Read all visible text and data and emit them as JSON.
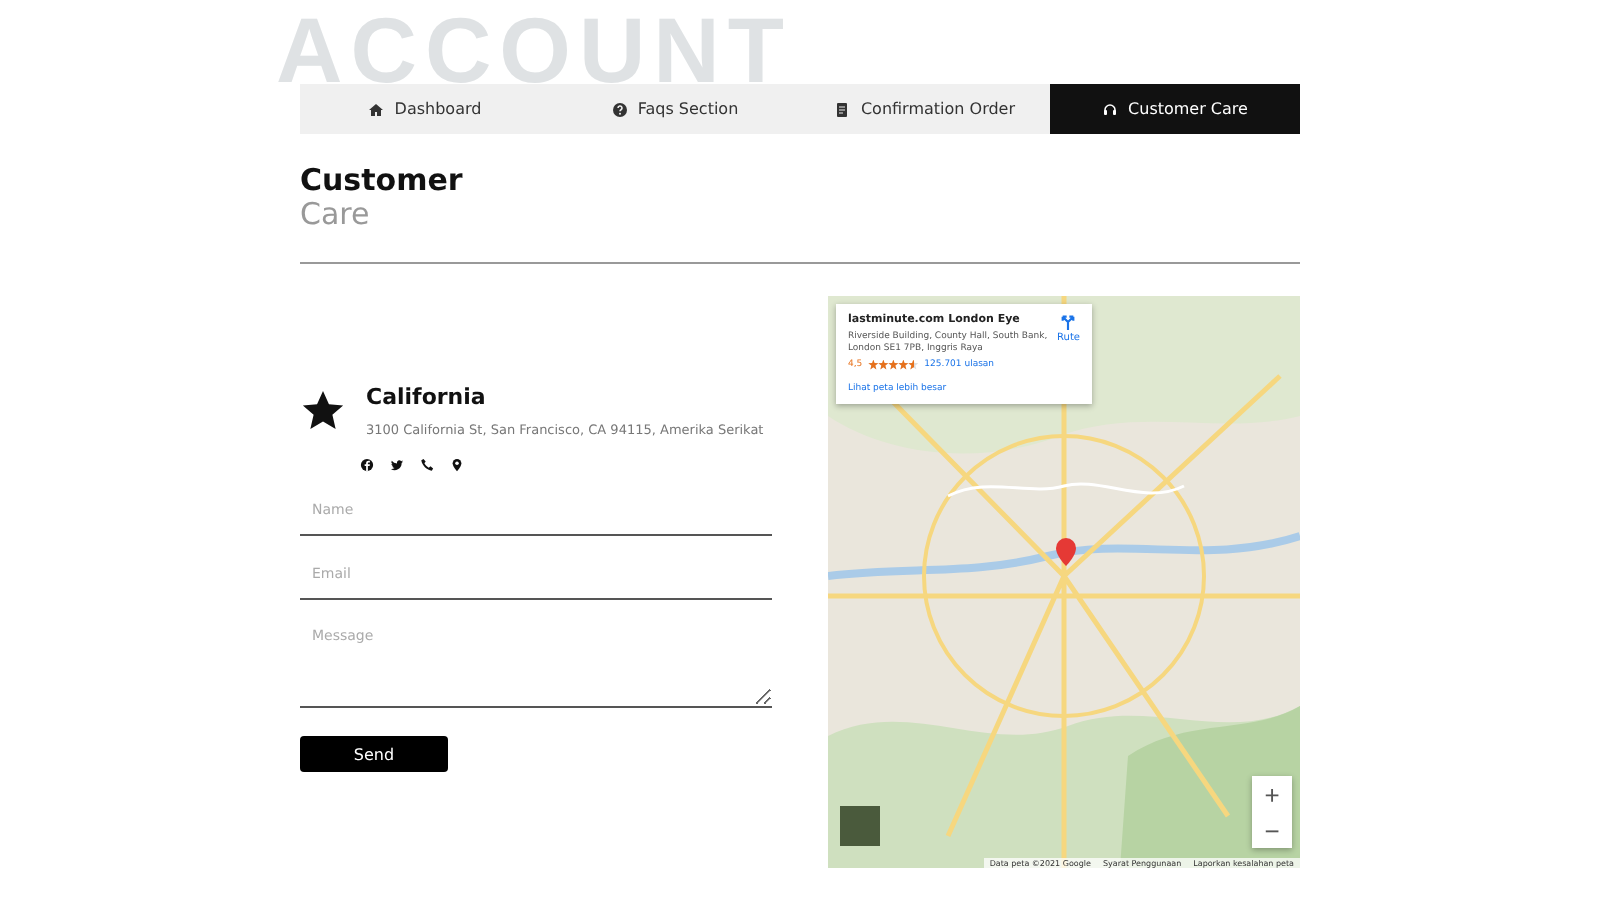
{
  "backdrop_title": "ACCOUNT",
  "tabs": [
    {
      "label": "Dashboard",
      "selected": false
    },
    {
      "label": "Faqs Section",
      "selected": false
    },
    {
      "label": "Confirmation Order",
      "selected": false
    },
    {
      "label": "Customer Care",
      "selected": true
    }
  ],
  "heading": {
    "title": "Customer",
    "subtitle": "Care"
  },
  "location": {
    "name": "California",
    "address": "3100 California St, San Francisco, CA 94115, Amerika Serikat"
  },
  "form": {
    "fields": [
      {
        "kind": "input",
        "placeholder": "Name"
      },
      {
        "kind": "input",
        "placeholder": "Email"
      },
      {
        "kind": "textarea",
        "placeholder": "Message"
      }
    ],
    "submit": "Send"
  },
  "map": {
    "place_card": {
      "title": "lastminute.com London Eye",
      "address": "Riverside Building, County Hall, South Bank, London SE1 7PB, Inggris Raya",
      "rating": "4,5",
      "stars": 4.5,
      "reviews": "125.701 ulasan",
      "directions": "Rute",
      "larger_map": "Lihat peta lebih besar"
    },
    "zoom_in": "+",
    "zoom_out": "−",
    "attribution": [
      "Data peta ©2021 Google",
      "Syarat Penggunaan",
      "Laporkan kesalahan peta"
    ]
  }
}
